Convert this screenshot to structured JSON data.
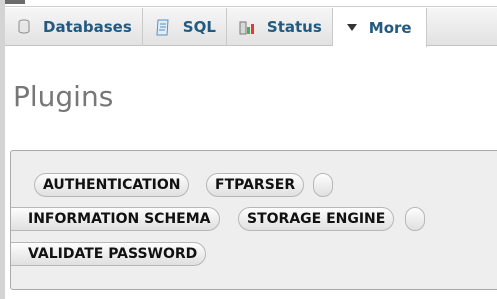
{
  "tabs": [
    {
      "label": "Databases",
      "icon": "database-icon"
    },
    {
      "label": "SQL",
      "icon": "sql-icon"
    },
    {
      "label": "Status",
      "icon": "status-icon"
    },
    {
      "label": "More",
      "icon": "triangle-down-icon"
    }
  ],
  "page_title": "Plugins",
  "plugin_types": [
    "AUTHENTICATION",
    "FTPARSER",
    "INFORMATION SCHEMA",
    "STORAGE ENGINE",
    "VALIDATE PASSWORD"
  ],
  "colors": {
    "tab_text": "#235a81",
    "title_text": "#777777",
    "panel_bg": "#eeeeee"
  }
}
